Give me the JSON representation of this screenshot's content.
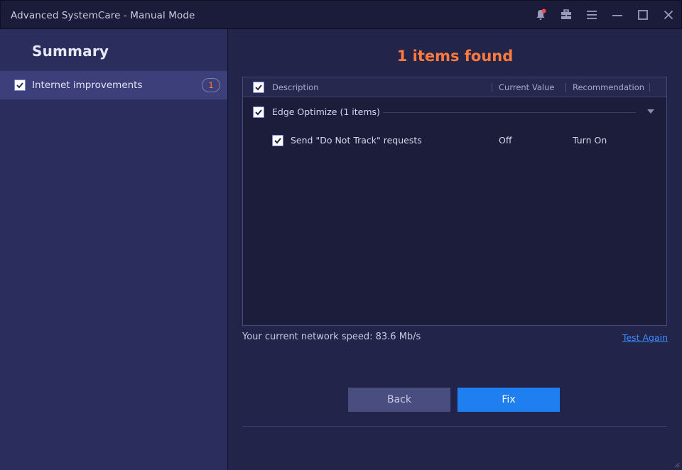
{
  "window": {
    "title": "Advanced SystemCare - Manual Mode"
  },
  "titlebar_icons": [
    {
      "name": "bell-notification-icon"
    },
    {
      "name": "toolbox-icon"
    },
    {
      "name": "menu-icon"
    },
    {
      "name": "minimize-icon"
    },
    {
      "name": "maximize-icon"
    },
    {
      "name": "close-icon"
    }
  ],
  "sidebar": {
    "title": "Summary",
    "items": [
      {
        "label": "Internet improvements",
        "count": "1",
        "checked": true
      }
    ]
  },
  "main": {
    "found_title": "1 items found",
    "table": {
      "headers": {
        "description": "Description",
        "current_value": "Current Value",
        "recommendation": "Recommendation"
      },
      "group": {
        "label": "Edge Optimize (1 items)",
        "checked": true
      },
      "items": [
        {
          "description": "Send \"Do Not Track\" requests",
          "current_value": "Off",
          "recommendation": "Turn On",
          "checked": true
        }
      ]
    },
    "speed_text": "Your current network speed: 83.6 Mb/s",
    "test_again": "Test Again",
    "buttons": {
      "back": "Back",
      "fix": "Fix"
    }
  },
  "colors": {
    "accent_orange": "#ff7a3d",
    "primary_blue": "#1f7ef0",
    "link_blue": "#3d8cff"
  }
}
